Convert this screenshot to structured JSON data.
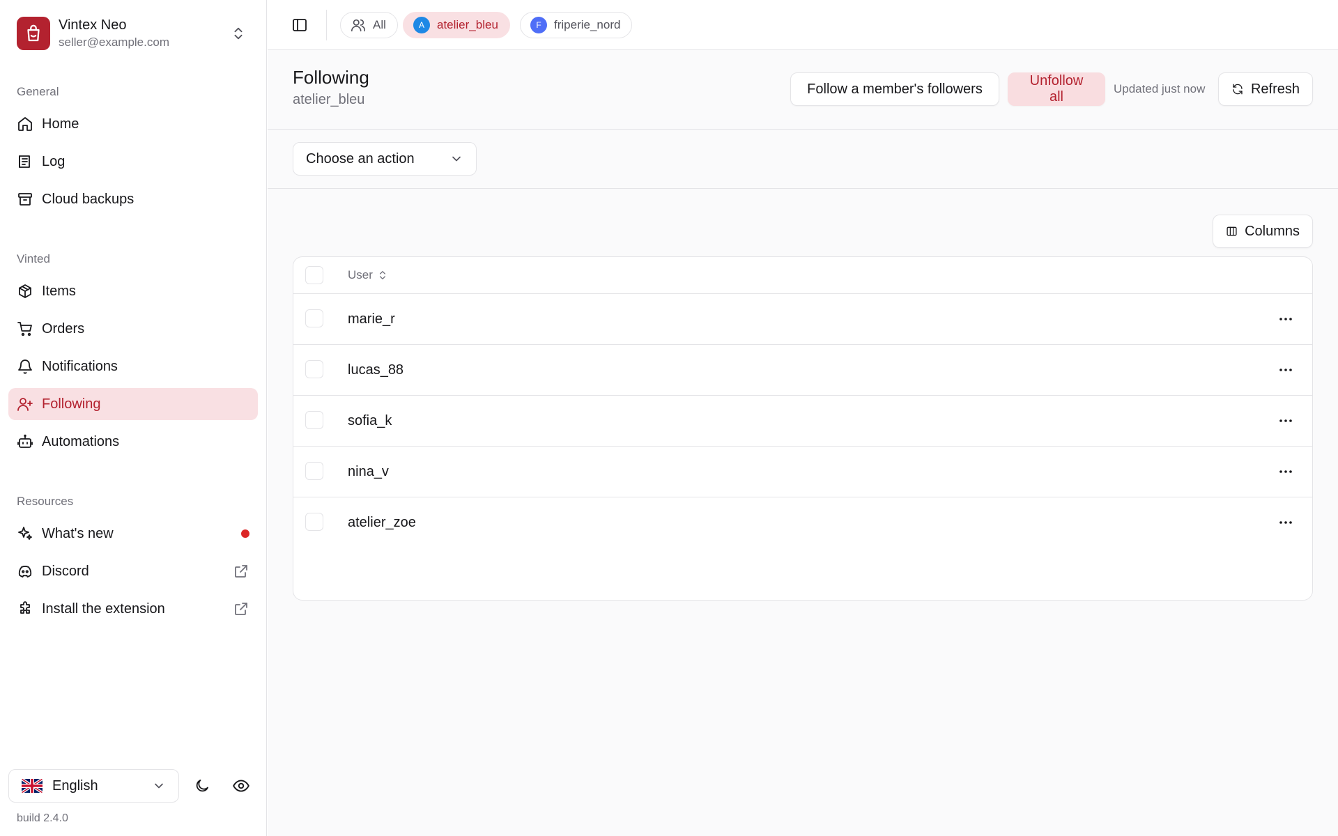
{
  "app": {
    "name": "Vintex Neo",
    "email": "seller@example.com",
    "build": "build 2.4.0"
  },
  "colors": {
    "accent": "#b3222f",
    "accent_soft": "#f9e0e3",
    "notification_dot": "#dc2626"
  },
  "sidebar": {
    "sections": {
      "general": "General",
      "vinted": "Vinted",
      "resources": "Resources"
    },
    "general_items": [
      {
        "label": "Home",
        "icon": "home-icon"
      },
      {
        "label": "Log",
        "icon": "log-icon"
      },
      {
        "label": "Cloud backups",
        "icon": "archive-icon"
      }
    ],
    "vinted_items": [
      {
        "label": "Items",
        "icon": "package-icon"
      },
      {
        "label": "Orders",
        "icon": "cart-icon"
      },
      {
        "label": "Notifications",
        "icon": "bell-icon"
      },
      {
        "label": "Following",
        "icon": "user-plus-icon",
        "active": true
      },
      {
        "label": "Automations",
        "icon": "bot-icon"
      }
    ],
    "resource_items": [
      {
        "label": "What's new",
        "icon": "sparkles-icon"
      },
      {
        "label": "Discord",
        "icon": "discord-icon"
      },
      {
        "label": "Install the extension",
        "icon": "puzzle-icon"
      }
    ],
    "language": "English"
  },
  "topbar": {
    "chips": [
      {
        "label": "All",
        "icon": "users-icon"
      },
      {
        "label": "atelier_bleu",
        "avatar": "A",
        "avatar_color": "#1e88e5",
        "active": true
      },
      {
        "label": "friperie_nord",
        "avatar": "F",
        "avatar_color": "#4f6ef7"
      }
    ]
  },
  "page": {
    "title": "Following",
    "subtitle": "atelier_bleu",
    "follow_button": "Follow a member's followers",
    "unfollow_button": "Unfollow all",
    "updated": "Updated just now",
    "refresh_button": "Refresh",
    "action_select": "Choose an action",
    "columns_button": "Columns"
  },
  "table": {
    "header_user": "User",
    "rows": [
      "marie_r",
      "lucas_88",
      "sofia_k",
      "nina_v",
      "atelier_zoe"
    ]
  }
}
